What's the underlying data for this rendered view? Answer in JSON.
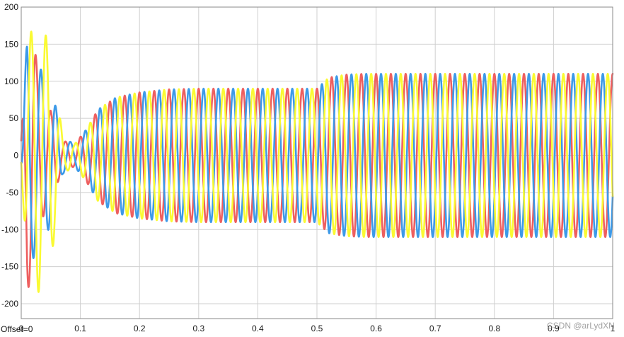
{
  "chart_data": {
    "type": "line",
    "title": "",
    "xlabel": "",
    "ylabel": "",
    "xlim": [
      0,
      1
    ],
    "ylim": [
      -220,
      200
    ],
    "x_ticks": [
      "0",
      "0.1",
      "0.2",
      "0.3",
      "0.4",
      "0.5",
      "0.6",
      "0.7",
      "0.8",
      "0.9",
      "1"
    ],
    "y_ticks": [
      "200",
      "150",
      "100",
      "50",
      "0",
      "-50",
      "-100",
      "-150",
      "-200"
    ],
    "grid": true,
    "background": "#ffffff",
    "series": [
      {
        "color": "#ee5f5f",
        "frequency_hz": 40,
        "phase_deg": 90,
        "envelope": [
          [
            0,
            20
          ],
          [
            0.01,
            180
          ],
          [
            0.02,
            170
          ],
          [
            0.03,
            95
          ],
          [
            0.05,
            60
          ],
          [
            0.07,
            20
          ],
          [
            0.09,
            15
          ],
          [
            0.11,
            35
          ],
          [
            0.13,
            62
          ],
          [
            0.16,
            78
          ],
          [
            0.2,
            85
          ],
          [
            0.25,
            89
          ],
          [
            0.3,
            90
          ],
          [
            0.5,
            90
          ],
          [
            0.52,
            105
          ],
          [
            0.55,
            109
          ],
          [
            0.58,
            110
          ],
          [
            1,
            110
          ]
        ]
      },
      {
        "color": "#3d9ae8",
        "frequency_hz": 40,
        "phase_deg": -30,
        "envelope": [
          [
            0,
            20
          ],
          [
            0.01,
            160
          ],
          [
            0.02,
            140
          ],
          [
            0.03,
            120
          ],
          [
            0.05,
            95
          ],
          [
            0.07,
            25
          ],
          [
            0.09,
            15
          ],
          [
            0.11,
            35
          ],
          [
            0.13,
            62
          ],
          [
            0.16,
            78
          ],
          [
            0.2,
            85
          ],
          [
            0.25,
            89
          ],
          [
            0.3,
            90
          ],
          [
            0.5,
            90
          ],
          [
            0.52,
            105
          ],
          [
            0.55,
            109
          ],
          [
            0.58,
            110
          ],
          [
            1,
            110
          ]
        ]
      },
      {
        "color": "#fafa32",
        "frequency_hz": 40,
        "phase_deg": 210,
        "envelope": [
          [
            0,
            20
          ],
          [
            0.01,
            150
          ],
          [
            0.02,
            175
          ],
          [
            0.03,
            185
          ],
          [
            0.05,
            145
          ],
          [
            0.07,
            25
          ],
          [
            0.09,
            15
          ],
          [
            0.11,
            35
          ],
          [
            0.13,
            62
          ],
          [
            0.16,
            78
          ],
          [
            0.2,
            85
          ],
          [
            0.25,
            89
          ],
          [
            0.3,
            90
          ],
          [
            0.5,
            90
          ],
          [
            0.52,
            105
          ],
          [
            0.55,
            109
          ],
          [
            0.58,
            110
          ],
          [
            1,
            110
          ]
        ]
      }
    ]
  },
  "status": {
    "offset_label": "Offset=0"
  },
  "watermark": "CSDN @arLydXN"
}
